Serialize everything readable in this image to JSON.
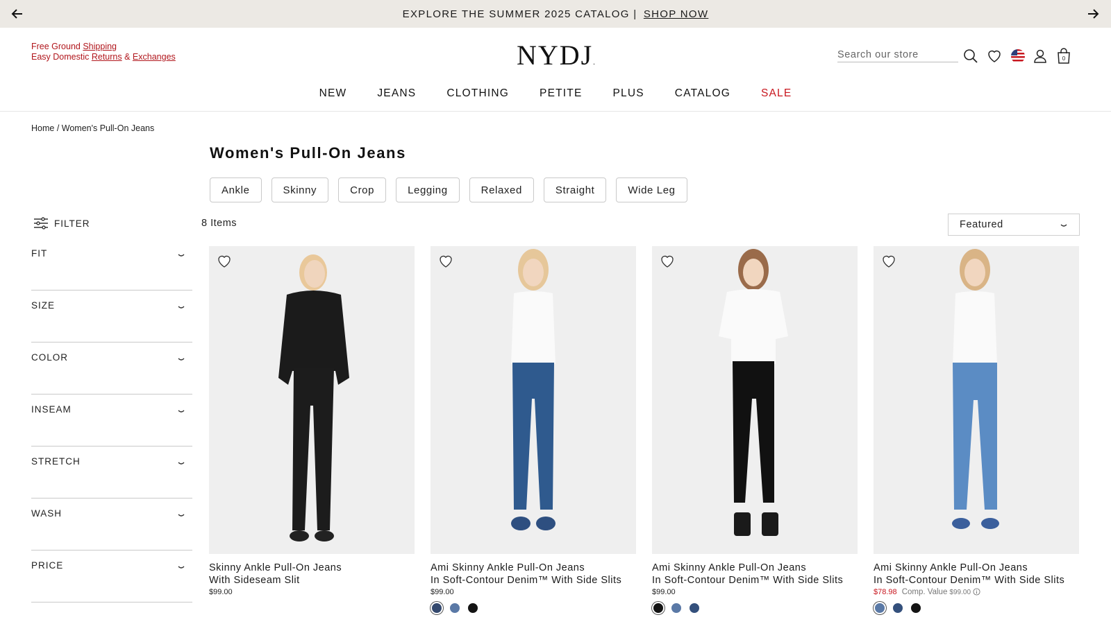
{
  "promo": {
    "text": "EXPLORE THE SUMMER 2025 CATALOG |",
    "link": "SHOP NOW"
  },
  "shipping": {
    "line1_prefix": "Free Ground ",
    "line1_link": "Shipping",
    "line2_prefix": "Easy Domestic ",
    "line2_link1": "Returns",
    "line2_amp": " & ",
    "line2_link2": "Exchanges"
  },
  "logo": "NYDJ",
  "search": {
    "placeholder": "Search our store"
  },
  "cart_count": "0",
  "nav": [
    "NEW",
    "JEANS",
    "CLOTHING",
    "PETITE",
    "PLUS",
    "CATALOG",
    "SALE"
  ],
  "breadcrumb": {
    "home": "Home",
    "sep": " / ",
    "current": "Women's Pull-On Jeans"
  },
  "page_title": "Women's Pull-On Jeans",
  "chips": [
    "Ankle",
    "Skinny",
    "Crop",
    "Legging",
    "Relaxed",
    "Straight",
    "Wide Leg"
  ],
  "filter_label": "FILTER",
  "items_count": "8 Items",
  "sort_value": "Featured",
  "facets": [
    "FIT",
    "SIZE",
    "COLOR",
    "INSEAM",
    "STRETCH",
    "WASH",
    "PRICE"
  ],
  "products": [
    {
      "name_line1": "Skinny Ankle Pull-On Jeans",
      "name_line2": "With Sideseam Slit",
      "price": "$99.00",
      "top_color": "#1b1b1b",
      "bottom_color": "#1c1c1c",
      "shoe_color": "#222222",
      "swatches": []
    },
    {
      "name_line1": "Ami Skinny Ankle Pull-On Jeans",
      "name_line2": "In Soft-Contour Denim™ With Side Slits",
      "price": "$99.00",
      "top_color": "#fafafa",
      "bottom_color": "#2f5a8e",
      "shoe_color": "#2e4f80",
      "swatches": [
        "#34496e",
        "#5a79a6",
        "#141414"
      ]
    },
    {
      "name_line1": "Ami Skinny Ankle Pull-On Jeans",
      "name_line2": "In Soft-Contour Denim™ With Side Slits",
      "price": "$99.00",
      "top_color": "#fafafa",
      "bottom_color": "#111111",
      "shoe_color": "#1a1a1a",
      "swatches": [
        "#141414",
        "#5a79a6",
        "#34507c"
      ]
    },
    {
      "name_line1": "Ami Skinny Ankle Pull-On Jeans",
      "name_line2": "In Soft-Contour Denim™ With Side Slits",
      "price": "",
      "sale_price": "$78.98",
      "comp_label": "Comp. Value",
      "comp_value": "$99.00",
      "top_color": "#fafafa",
      "bottom_color": "#5b8cc4",
      "shoe_color": "#3b5f9c",
      "swatches": [
        "#5a79a6",
        "#34507c",
        "#141414"
      ]
    }
  ],
  "colors": {
    "accent_red": "#c8161e",
    "promo_bg": "#ece9e4"
  }
}
